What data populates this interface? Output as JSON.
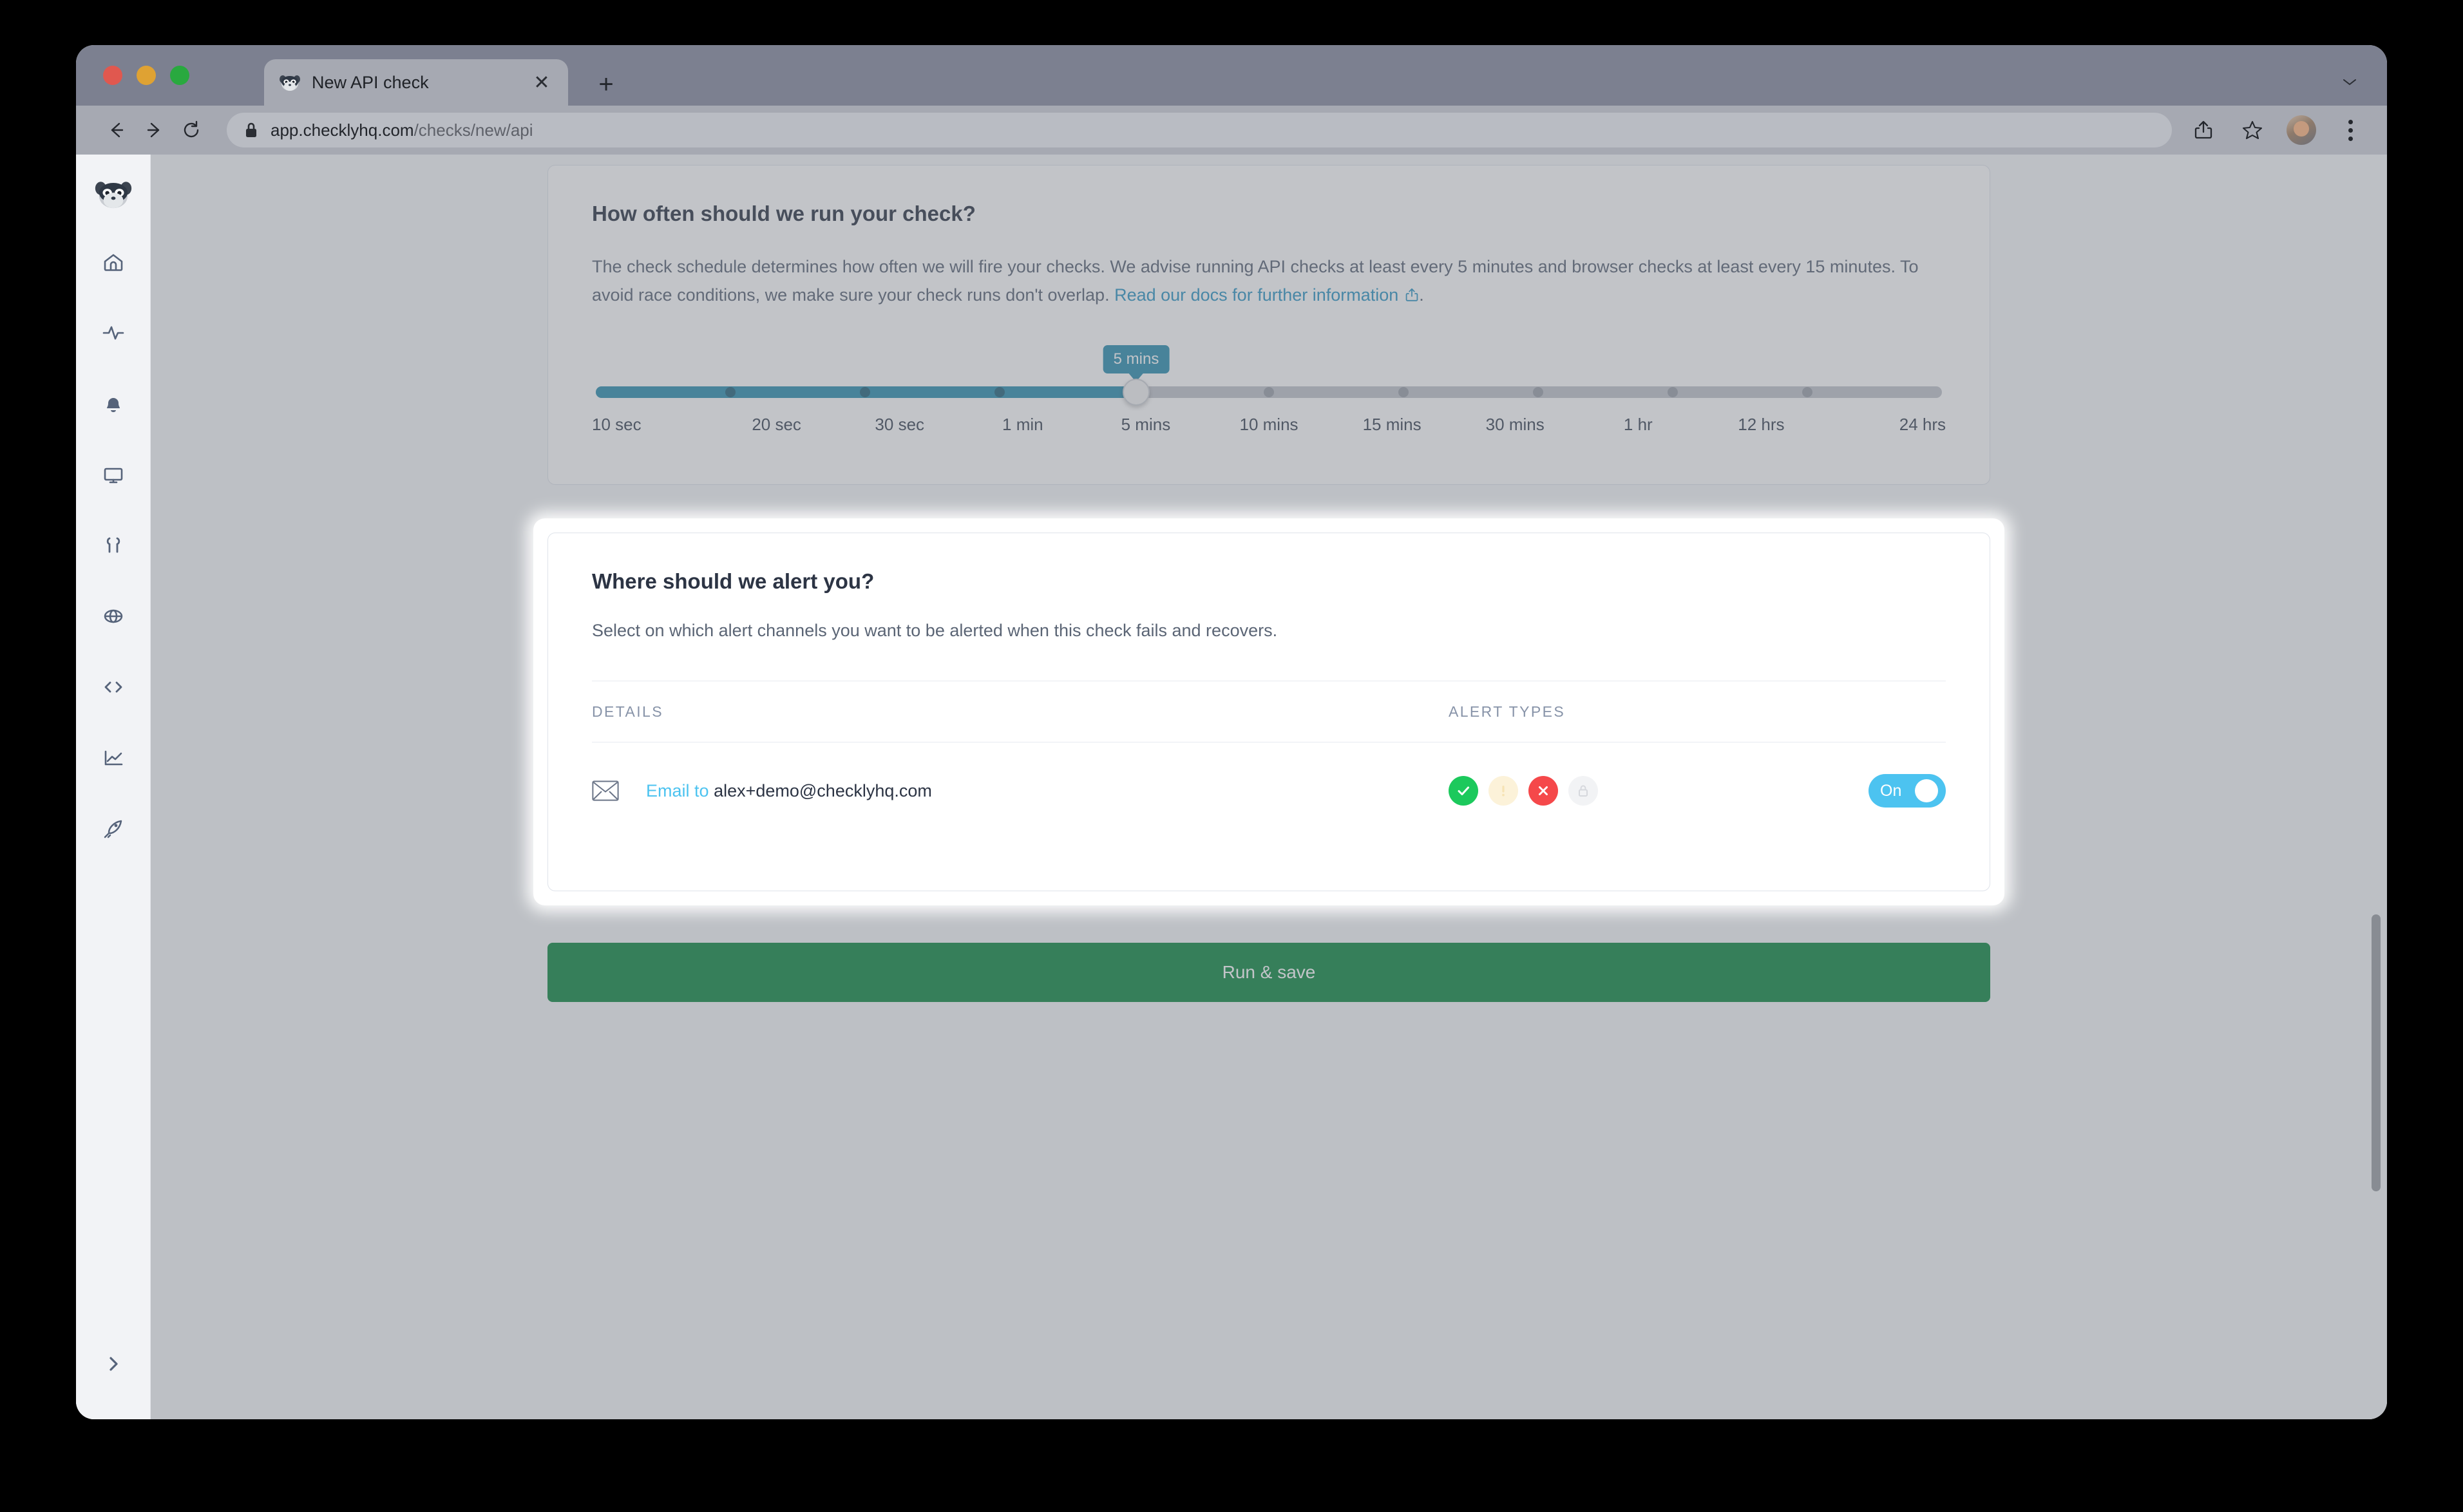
{
  "browser": {
    "tab": {
      "title": "New API check",
      "favicon": "raccoon-favicon",
      "close_label": "✕"
    },
    "new_tab_label": "+",
    "url_secure": "app.checklyhq.com",
    "url_path": "/checks/new/api",
    "back_label": "←",
    "forward_label": "→",
    "reload_label": "⟳"
  },
  "sidebar": {
    "logo": "checkly-raccoon-logo",
    "items": [
      {
        "icon": "home-icon"
      },
      {
        "icon": "activity-pulse-icon"
      },
      {
        "icon": "bell-icon"
      },
      {
        "icon": "monitor-icon"
      },
      {
        "icon": "wrench-icon"
      },
      {
        "icon": "globe-icon"
      },
      {
        "icon": "code-brackets-icon"
      },
      {
        "icon": "line-chart-icon"
      },
      {
        "icon": "rocket-icon"
      }
    ],
    "expand_label": "›"
  },
  "schedule_card": {
    "title": "How often should we run your check?",
    "description_before": "The check schedule determines how often we will fire your checks. We advise running API checks at least every 5 minutes and browser checks at least every 15 minutes. To avoid race conditions, we make sure your check runs don't overlap. ",
    "link_text": "Read our docs for further information",
    "description_after": ".",
    "slider": {
      "tooltip": "5 mins",
      "selected_index": 4,
      "selected_value": "5 mins",
      "options": [
        "10 sec",
        "20 sec",
        "30 sec",
        "1 min",
        "5 mins",
        "10 mins",
        "15 mins",
        "30 mins",
        "1 hr",
        "12 hrs",
        "24 hrs"
      ]
    }
  },
  "alert_card": {
    "title": "Where should we alert you?",
    "description": "Select on which alert channels you want to be alerted when this check fails and recovers.",
    "columns": {
      "details": "DETAILS",
      "alert_types": "ALERT TYPES"
    },
    "rows": [
      {
        "icon": "envelope-icon",
        "label": "Email to",
        "value": "alex+demo@checklyhq.com",
        "alert_types": [
          {
            "name": "recovery-badge",
            "glyph": "check",
            "active": true
          },
          {
            "name": "degraded-badge",
            "glyph": "exclamation",
            "active": false
          },
          {
            "name": "failure-badge",
            "glyph": "cross",
            "active": true
          },
          {
            "name": "ssl-badge",
            "glyph": "lock",
            "active": false
          }
        ],
        "toggle": {
          "label": "On",
          "state": true
        }
      }
    ]
  },
  "actions": {
    "run_save": "Run & save"
  },
  "colors": {
    "accent_blue": "#4cc3f0",
    "slider_teal": "#2e8fb0",
    "success_green": "#1cc95c",
    "failure_red": "#f5484a",
    "warn_cream": "#fcf2d9",
    "save_green": "#0e8843",
    "link_blue": "#2f97c4"
  }
}
